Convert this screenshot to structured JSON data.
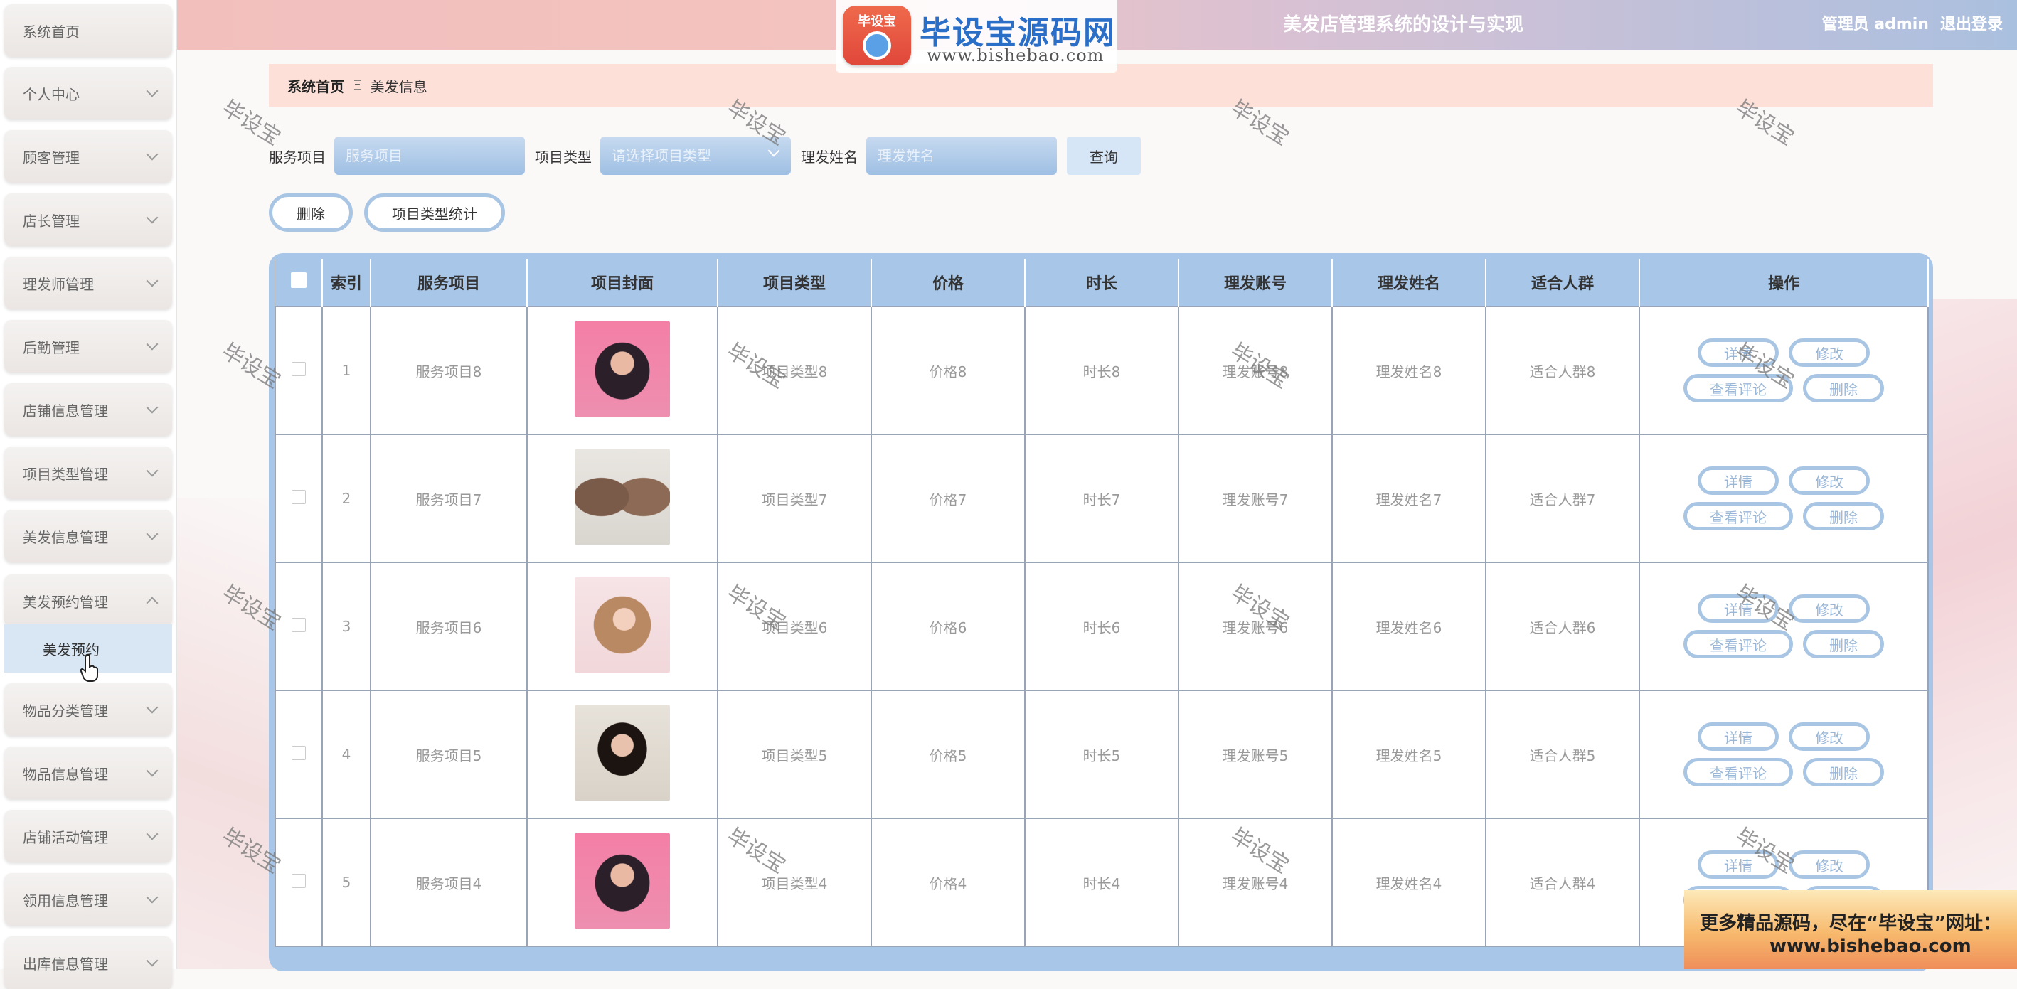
{
  "app": {
    "title": "美发店管理系统的设计与实现",
    "user_label": "管理员 admin",
    "logout": "退出登录"
  },
  "logo": {
    "badge": "毕设宝",
    "title": "毕设宝源码网",
    "url": "www.bishebao.com"
  },
  "sidebar": {
    "items": [
      {
        "label": "系统首页"
      },
      {
        "label": "个人中心"
      },
      {
        "label": "顾客管理"
      },
      {
        "label": "店长管理"
      },
      {
        "label": "理发师管理"
      },
      {
        "label": "后勤管理"
      },
      {
        "label": "店铺信息管理"
      },
      {
        "label": "项目类型管理"
      },
      {
        "label": "美发信息管理"
      },
      {
        "label": "美发预约管理"
      },
      {
        "label": "物品分类管理"
      },
      {
        "label": "物品信息管理"
      },
      {
        "label": "店铺活动管理"
      },
      {
        "label": "领用信息管理"
      },
      {
        "label": "出库信息管理"
      }
    ],
    "sub_item": "美发预约"
  },
  "breadcrumb": {
    "home": "系统首页",
    "sep": "Ξ",
    "current": "美发信息"
  },
  "search": {
    "service_label": "服务项目",
    "service_placeholder": "服务项目",
    "type_label": "项目类型",
    "type_placeholder": "请选择项目类型",
    "name_label": "理发姓名",
    "name_placeholder": "理发姓名",
    "query": "查询"
  },
  "actions": {
    "delete": "删除",
    "stats": "项目类型统计"
  },
  "table": {
    "headers": [
      "索引",
      "服务项目",
      "项目封面",
      "项目类型",
      "价格",
      "时长",
      "理发账号",
      "理发姓名",
      "适合人群",
      "操作"
    ],
    "op_labels": {
      "detail": "详情",
      "edit": "修改",
      "comments": "查看评论",
      "delete": "删除"
    },
    "rows": [
      {
        "index": "1",
        "service": "服务项目8",
        "type": "项目类型8",
        "price": "价格8",
        "duration": "时长8",
        "account": "理发账号8",
        "name": "理发姓名8",
        "crowd": "适合人群8",
        "cover": "pink-bob"
      },
      {
        "index": "2",
        "service": "服务项目7",
        "type": "项目类型7",
        "price": "价格7",
        "duration": "时长7",
        "account": "理发账号7",
        "name": "理发姓名7",
        "crowd": "适合人群7",
        "cover": "brown-bob-back"
      },
      {
        "index": "3",
        "service": "服务项目6",
        "type": "项目类型6",
        "price": "价格6",
        "duration": "时长6",
        "account": "理发账号6",
        "name": "理发姓名6",
        "crowd": "适合人群6",
        "cover": "curly-light"
      },
      {
        "index": "4",
        "service": "服务项目5",
        "type": "项目类型5",
        "price": "价格5",
        "duration": "时长5",
        "account": "理发账号5",
        "name": "理发姓名5",
        "crowd": "适合人群5",
        "cover": "dark-bob"
      },
      {
        "index": "5",
        "service": "服务项目4",
        "type": "项目类型4",
        "price": "价格4",
        "duration": "时长4",
        "account": "理发账号4",
        "name": "理发姓名4",
        "crowd": "适合人群4",
        "cover": "pink-bob"
      }
    ]
  },
  "watermark": "毕设宝",
  "promo": {
    "line1": "更多精品源码，尽在“毕设宝”网址：",
    "line2": "www.bishebao.com"
  },
  "colors": {
    "accent_blue": "#a8c6e7",
    "breadcrumb_bg": "#fde1d8",
    "header_start": "#f2bfbd",
    "header_end": "#aac0df"
  }
}
